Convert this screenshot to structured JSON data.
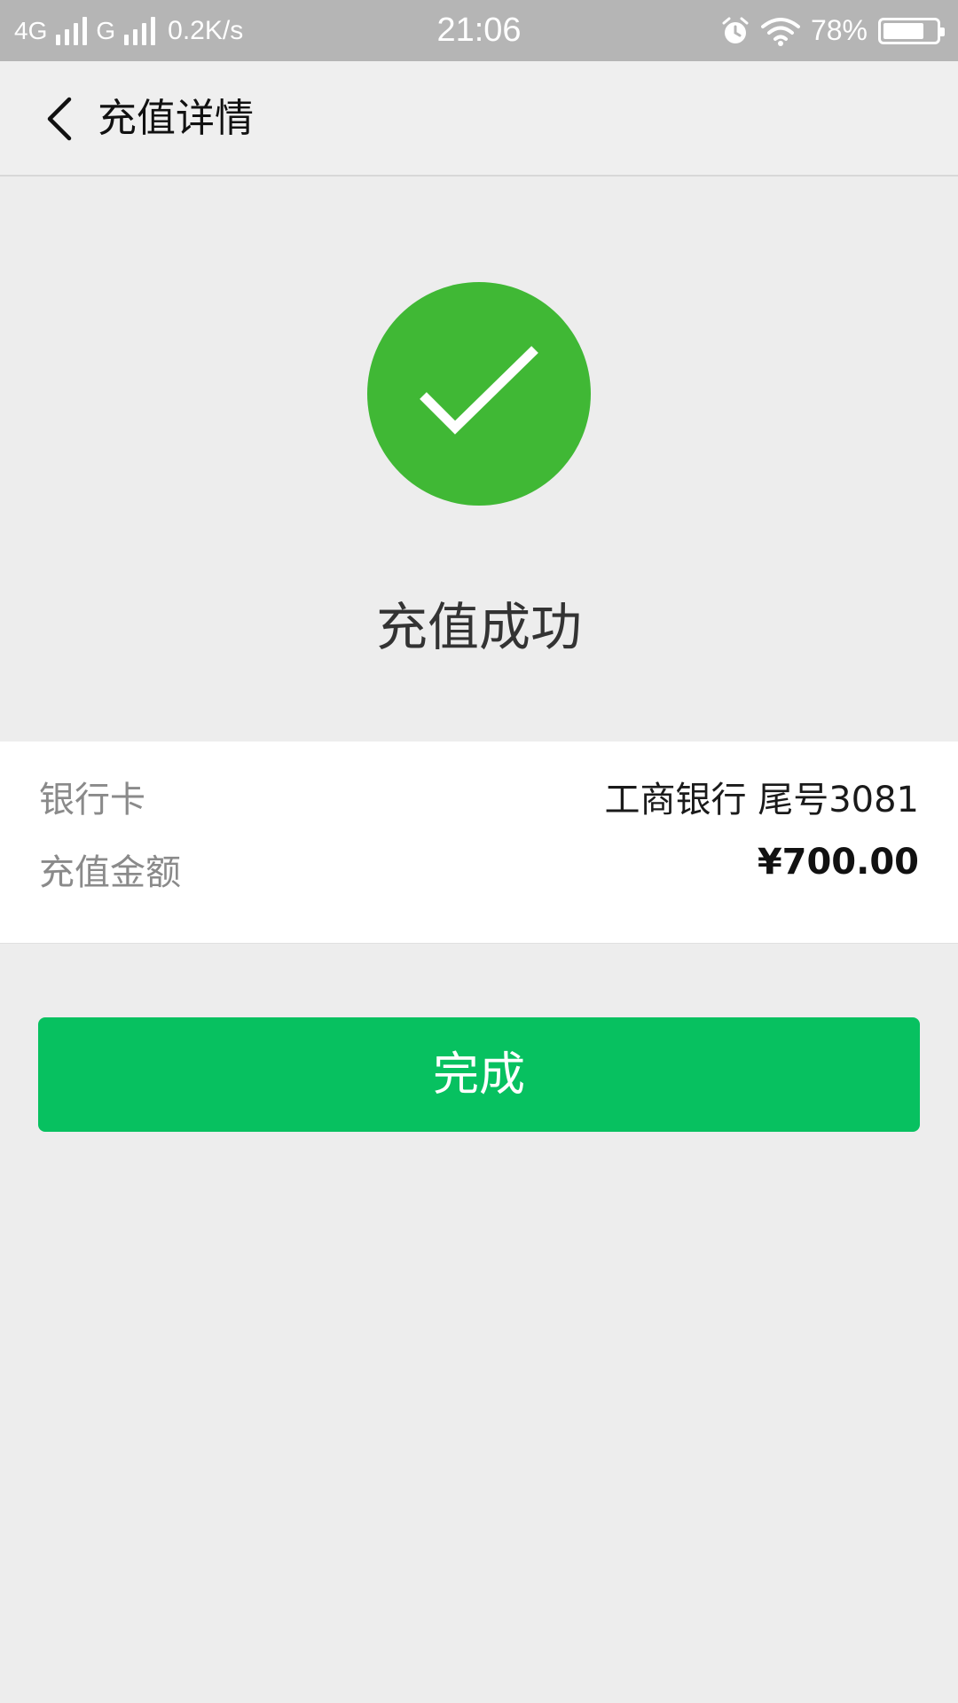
{
  "status_bar": {
    "network_1": "4G",
    "network_2": "G",
    "speed": "0.2K/s",
    "time": "21:06",
    "battery": "78%",
    "battery_level": 0.78,
    "icons": [
      "signal-icon",
      "alarm-icon",
      "wifi-icon",
      "battery-icon"
    ]
  },
  "nav": {
    "title": "充值详情",
    "back_icon": "chevron-left-icon"
  },
  "result": {
    "icon": "check-circle-icon",
    "message": "充值成功"
  },
  "details": {
    "bank_label": "银行卡",
    "bank_value": "工商银行 尾号3081",
    "amount_label": "充值金额",
    "amount_value": "¥700.00"
  },
  "actions": {
    "done_label": "完成"
  },
  "colors": {
    "success_green": "#40b835",
    "button_green": "#07c160",
    "background": "#ededed"
  }
}
